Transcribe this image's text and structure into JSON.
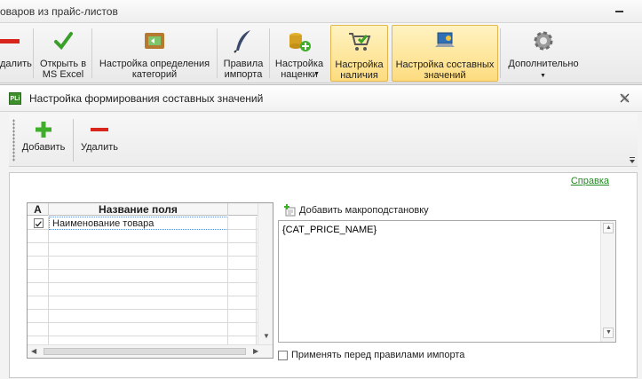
{
  "app": {
    "title_fragment": "оваров из прайс-листов"
  },
  "ribbon": {
    "buttons": [
      {
        "label": "далить",
        "icon": "delete-icon"
      },
      {
        "label": "Открыть в\nMS Excel",
        "icon": "excel-check-icon"
      },
      {
        "label": "Настройка определения\nкатегорий",
        "icon": "category-folder-icon"
      },
      {
        "label": "Правила\nимпорта",
        "icon": "quill-pen-icon"
      },
      {
        "label": "Настройка\nнаценки",
        "icon": "coins-plus-icon"
      },
      {
        "label": "Настройка\nналичия",
        "icon": "cart-check-icon"
      },
      {
        "label": "Настройка составных\nзначений",
        "icon": "laptop-settings-icon"
      },
      {
        "label": "Дополнительно",
        "icon": "gear-icon"
      }
    ]
  },
  "dialog": {
    "title": "Настройка формирования составных значений",
    "logo_text": "PLi",
    "toolbar": {
      "add_label": "Добавить",
      "delete_label": "Удалить"
    },
    "help_link": "Справка",
    "grid": {
      "columns": [
        "А",
        "Название поля"
      ],
      "rows": [
        {
          "checked": true,
          "name": "Наименование товара"
        }
      ]
    },
    "add_macro_label": "Добавить макроподстановку",
    "macro_text": "{CAT_PRICE_NAME}",
    "apply_checkbox_label": "Применять перед правилами импорта",
    "apply_checked": false
  },
  "colors": {
    "active_button": "#fddc7f",
    "link": "#1f8a1f",
    "add_green": "#3fae2a",
    "delete_red": "#d9261c"
  }
}
